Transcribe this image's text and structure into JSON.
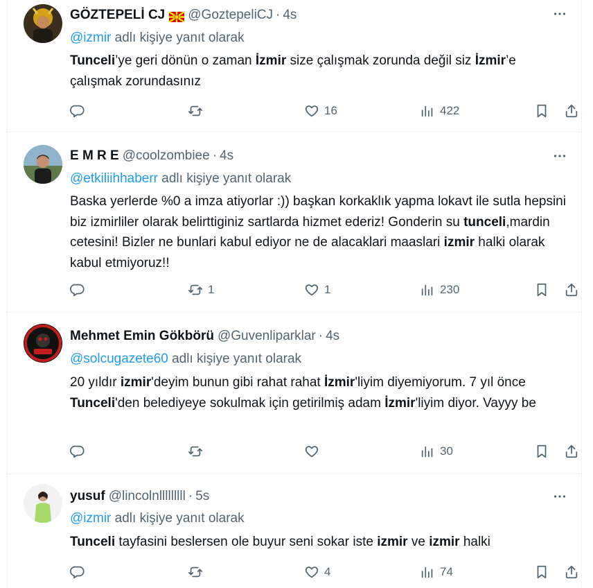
{
  "reply_prefix_suffix": "adlı kişiye yanıt olarak",
  "tweets": [
    {
      "name": "GÖZTEPELİ CJ",
      "handle": "@GoztepeliCJ",
      "dot": "·",
      "time": "4s",
      "reply_mention": "@izmir",
      "reply_suffix": "adlı kişiye yanıt olarak",
      "text_segments": [
        {
          "t": "Tunceli",
          "b": true
        },
        {
          "t": "’ye geri dönün o zaman ",
          "b": false
        },
        {
          "t": "İzmir",
          "b": true
        },
        {
          "t": " size çalışmak zorunda değil siz ",
          "b": false
        },
        {
          "t": "İzmir",
          "b": true
        },
        {
          "t": "’e çalışmak zorundasınız",
          "b": false
        }
      ],
      "replies": "",
      "retweets": "",
      "likes": "16",
      "views": "422",
      "avatar_icon": "avatar-goztepe",
      "flag_icon": "macedonia-flag-icon"
    },
    {
      "name": "E M R E",
      "handle": "@coolzombiee",
      "dot": "·",
      "time": "4s",
      "reply_mention": "@etkiliihhaberr",
      "reply_suffix": "adlı kişiye yanıt olarak",
      "text_segments": [
        {
          "t": "Baska yerlerde %0 a imza atiyorlar :)) başkan korkaklık yapma lokavt ile sutla hepsini biz izmirliler olarak belirttiginiz sartlarda hizmet ederiz! Gonderin su ",
          "b": false
        },
        {
          "t": "tunceli",
          "b": true
        },
        {
          "t": ",mardin cetesini! Bizler ne bunlari kabul ediyor ne de alacaklari maaslari ",
          "b": false
        },
        {
          "t": "izmir",
          "b": true
        },
        {
          "t": " halki olarak kabul etmiyoruz!!",
          "b": false
        }
      ],
      "replies": "",
      "retweets": "1",
      "likes": "1",
      "views": "230",
      "avatar_icon": "avatar-emre"
    },
    {
      "name": "Mehmet Emin Gökbörü",
      "handle": "@Guvenliparklar",
      "dot": "·",
      "time": "4s",
      "reply_mention": "@solcugazete60",
      "reply_suffix": "adlı kişiye yanıt olarak",
      "text_segments": [
        {
          "t": "20 yıldır ",
          "b": false
        },
        {
          "t": "izmir",
          "b": true
        },
        {
          "t": "'deyim bunun gibi rahat rahat ",
          "b": false
        },
        {
          "t": "İzmir",
          "b": true
        },
        {
          "t": "'liyim diyemiyorum. 7 yıl önce ",
          "b": false
        },
        {
          "t": "Tunceli",
          "b": true
        },
        {
          "t": "'den belediyeye sokulmak için getirilmiş adam ",
          "b": false
        },
        {
          "t": "İzmir",
          "b": true
        },
        {
          "t": "'liyim diyor. Vayyy be",
          "b": false
        }
      ],
      "replies": "",
      "retweets": "",
      "likes": "",
      "views": "30",
      "avatar_icon": "avatar-mehmet"
    },
    {
      "name": "yusuf",
      "handle": "@lincolnlllllllll",
      "dot": "·",
      "time": "5s",
      "reply_mention": "@izmir",
      "reply_suffix": "adlı kişiye yanıt olarak",
      "text_segments": [
        {
          "t": "Tunceli",
          "b": true
        },
        {
          "t": " tayfasini beslersen ole buyur seni sokar iste ",
          "b": false
        },
        {
          "t": "izmir",
          "b": true
        },
        {
          "t": " ve ",
          "b": false
        },
        {
          "t": "izmir",
          "b": true
        },
        {
          "t": " halki",
          "b": false
        }
      ],
      "replies": "",
      "retweets": "",
      "likes": "4",
      "views": "74",
      "avatar_icon": "avatar-yusuf"
    }
  ],
  "colors": {
    "text": "#0f1419",
    "secondary": "#536471",
    "link": "#1d9bf0",
    "border": "#eff3f4"
  }
}
